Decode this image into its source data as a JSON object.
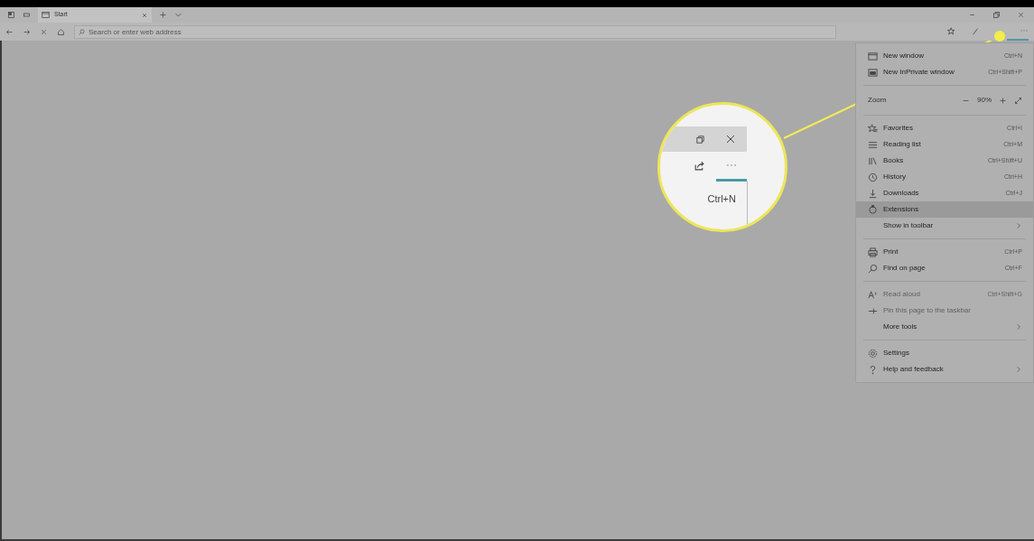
{
  "tabs": [
    {
      "label": "Start",
      "selected": true
    }
  ],
  "address_bar": {
    "placeholder": "Search or enter web address"
  },
  "menu": {
    "items": [
      {
        "kind": "item",
        "label": "New window",
        "shortcut": "Ctrl+N",
        "disabled": false,
        "selected": false,
        "submenu": false
      },
      {
        "kind": "item",
        "label": "New InPrivate window",
        "shortcut": "Ctrl+Shift+P",
        "disabled": false,
        "selected": false,
        "submenu": false
      },
      {
        "kind": "divider"
      },
      {
        "kind": "zoom",
        "label": "Zoom",
        "value": "90%"
      },
      {
        "kind": "divider"
      },
      {
        "kind": "item",
        "label": "Favorites",
        "shortcut": "Ctrl+I",
        "disabled": false,
        "selected": false,
        "submenu": false
      },
      {
        "kind": "item",
        "label": "Reading list",
        "shortcut": "Ctrl+M",
        "disabled": false,
        "selected": false,
        "submenu": false
      },
      {
        "kind": "item",
        "label": "Books",
        "shortcut": "Ctrl+Shift+U",
        "disabled": false,
        "selected": false,
        "submenu": false
      },
      {
        "kind": "item",
        "label": "History",
        "shortcut": "Ctrl+H",
        "disabled": false,
        "selected": false,
        "submenu": false
      },
      {
        "kind": "item",
        "label": "Downloads",
        "shortcut": "Ctrl+J",
        "disabled": false,
        "selected": false,
        "submenu": false
      },
      {
        "kind": "item",
        "label": "Extensions",
        "disabled": false,
        "selected": true,
        "submenu": false
      },
      {
        "kind": "item",
        "label": "Show in toolbar",
        "disabled": false,
        "selected": false,
        "submenu": true
      },
      {
        "kind": "divider"
      },
      {
        "kind": "item",
        "label": "Print",
        "shortcut": "Ctrl+P",
        "disabled": false,
        "selected": false,
        "submenu": false
      },
      {
        "kind": "item",
        "label": "Find on page",
        "shortcut": "Ctrl+F",
        "disabled": false,
        "selected": false,
        "submenu": false
      },
      {
        "kind": "divider"
      },
      {
        "kind": "item",
        "label": "Read aloud",
        "shortcut": "Ctrl+Shift+G",
        "disabled": true,
        "selected": false,
        "submenu": false
      },
      {
        "kind": "item",
        "label": "Pin this page to the taskbar",
        "disabled": true,
        "selected": false,
        "submenu": false
      },
      {
        "kind": "item",
        "label": "More tools",
        "disabled": false,
        "selected": false,
        "submenu": true
      },
      {
        "kind": "divider"
      },
      {
        "kind": "item",
        "label": "Settings",
        "disabled": false,
        "selected": false,
        "submenu": false
      },
      {
        "kind": "item",
        "label": "Help and feedback",
        "disabled": false,
        "selected": false,
        "submenu": true
      }
    ]
  },
  "magnifier": {
    "shortcut": "Ctrl+N"
  }
}
